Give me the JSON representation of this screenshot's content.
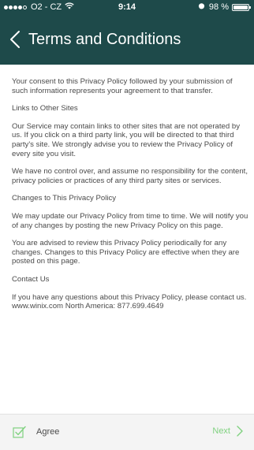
{
  "status_bar": {
    "carrier": "O2 - CZ",
    "time": "9:14",
    "battery": "98 %",
    "battery_level": 0.98
  },
  "header": {
    "back_icon": "chevron-left-icon",
    "title": "Terms and Conditions",
    "background_color": "#1e4a4a"
  },
  "content": {
    "paragraphs": [
      "Your consent to this Privacy Policy followed by your submission of such information represents your agreement to that transfer.",
      "Links to Other Sites",
      "Our Service may contain links to other sites that are not operated by us. If you click on a third party link, you will be directed to that third party's site. We strongly advise you to review the Privacy Policy of every site you visit.",
      "We have no control over, and assume no responsibility for the content, privacy policies or practices of any third party sites or services.",
      "Changes to This Privacy Policy",
      "We may update our Privacy Policy from time to time. We will notify you of any changes by posting the new Privacy Policy on this page.",
      "You are advised to review this Privacy Policy periodically for any changes. Changes to this Privacy Policy are effective when they are posted on this page.",
      "Contact Us",
      "If you have any questions about this Privacy Policy, please contact us.",
      "www.winix.com North America: 877.699.4649"
    ]
  },
  "footer": {
    "agree_label": "Agree",
    "agree_icon": "checkbox-check-icon",
    "next_label": "Next",
    "next_icon": "chevron-right-icon",
    "accent_color": "#7fd17f"
  }
}
